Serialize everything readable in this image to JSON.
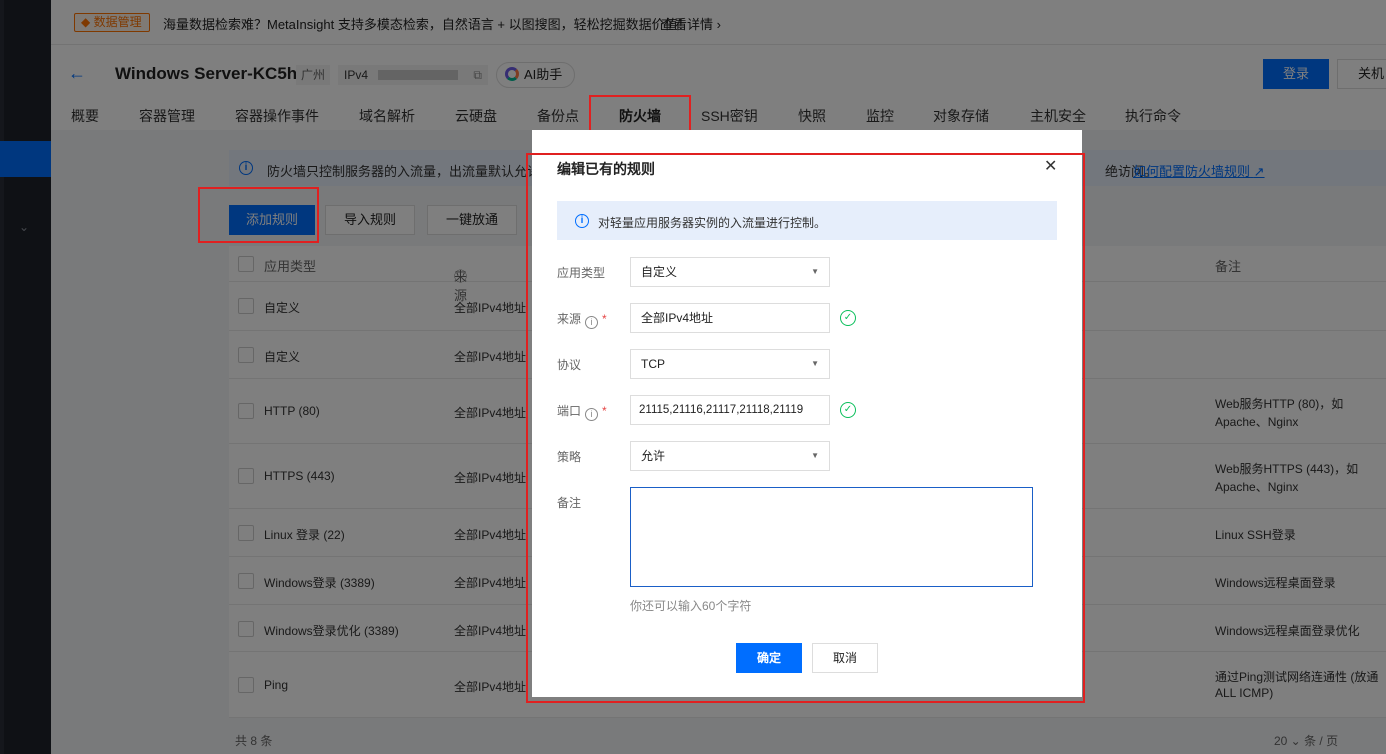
{
  "announcement": {
    "badge": "数据管理",
    "text": "海量数据检索难？MetaInsight 支持多模态检索，自然语言 + 以图搜图，轻松挖掘数据价值！",
    "link": "查看详情 ›"
  },
  "header": {
    "back": "←",
    "title": "Windows Server-KC5h",
    "region": "广州",
    "ip_prefix": "IPv4",
    "ai_assistant": "AI助手",
    "login": "登录",
    "shutdown": "关机"
  },
  "tabs": [
    "概要",
    "容器管理",
    "容器操作事件",
    "域名解析",
    "云硬盘",
    "备份点",
    "防火墙",
    "SSH密钥",
    "快照",
    "监控",
    "对象存储",
    "主机安全",
    "执行命令"
  ],
  "content": {
    "info_text": "防火墙只控制服务器的入流量，出流量默认允许所",
    "info_tail": "绝访问。",
    "info_link": "如何配置防火墙规则",
    "add_rule": "添加规则",
    "import_rule": "导入规则",
    "one_click": "一键放通",
    "headers": {
      "type": "应用类型",
      "source": "来源",
      "note": "备注"
    },
    "rows": [
      {
        "type": "自定义",
        "source": "全部IPv4地址",
        "note": "",
        "note2": ""
      },
      {
        "type": "自定义",
        "source": "全部IPv4地址",
        "note": "",
        "note2": ""
      },
      {
        "type": "HTTP (80)",
        "source": "全部IPv4地址",
        "note": "Web服务HTTP (80)，如",
        "note2": "Apache、Nginx"
      },
      {
        "type": "HTTPS (443)",
        "source": "全部IPv4地址",
        "note": "Web服务HTTPS (443)，如",
        "note2": "Apache、Nginx"
      },
      {
        "type": "Linux 登录 (22)",
        "source": "全部IPv4地址",
        "note": "Linux SSH登录",
        "note2": ""
      },
      {
        "type": "Windows登录 (3389)",
        "source": "全部IPv4地址",
        "note": "Windows远程桌面登录",
        "note2": ""
      },
      {
        "type": "Windows登录优化 (3389)",
        "source": "全部IPv4地址",
        "note": "Windows远程桌面登录优化",
        "note2": ""
      },
      {
        "type": "Ping",
        "source": "全部IPv4地址",
        "note": "通过Ping测试网络连通性 (放通",
        "note2": "ALL ICMP)"
      }
    ],
    "total": "共 8 条",
    "page_size": "20 ⌄  条 / 页"
  },
  "dialog": {
    "title": "编辑已有的规则",
    "close": "✕",
    "info": "对轻量应用服务器实例的入流量进行控制。",
    "fields": {
      "app_type_label": "应用类型",
      "app_type_value": "自定义",
      "source_label": "来源",
      "source_value": "全部IPv4地址",
      "protocol_label": "协议",
      "protocol_value": "TCP",
      "port_label": "端口",
      "port_value": "21115,21116,21117,21118,21119",
      "policy_label": "策略",
      "policy_value": "允许",
      "note_label": "备注",
      "note_hint": "你还可以输入60个字符"
    },
    "ok": "确定",
    "cancel": "取消"
  },
  "colors": {
    "primary": "#006eff",
    "highlight": "#e02020",
    "success": "#0abf5b"
  }
}
